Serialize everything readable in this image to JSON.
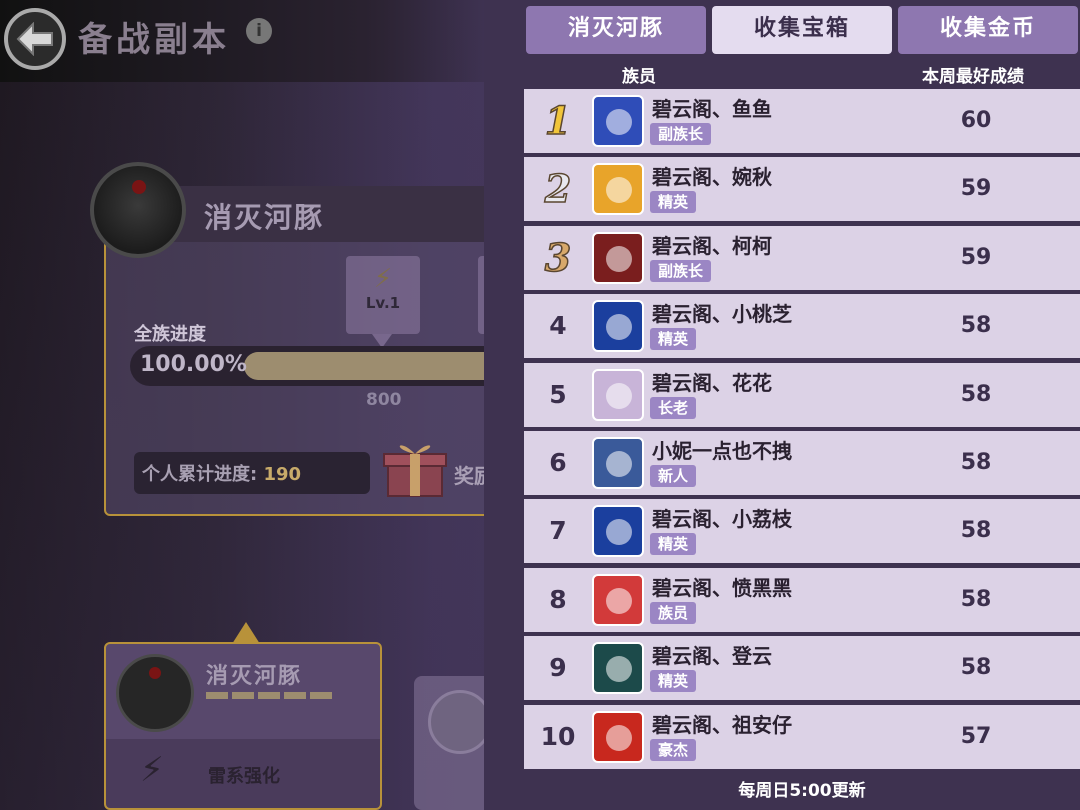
{
  "header": {
    "title": "备战副本",
    "info_icon": "i"
  },
  "dungeon": {
    "name": "消灭河豚",
    "level": "Lv.1",
    "progress_label": "全族进度",
    "progress": "100.00%",
    "progress_fraction": 1.0,
    "milestone": "800",
    "personal_label": "个人累计进度:",
    "personal_value": "190",
    "reward_label": "奖励"
  },
  "sub_dungeon": {
    "name": "消灭河豚",
    "buff": "雷系强化"
  },
  "tabs": [
    {
      "label": "消灭河豚",
      "active": false
    },
    {
      "label": "收集宝箱",
      "active": true
    },
    {
      "label": "收集金币",
      "active": false
    }
  ],
  "columns": {
    "member": "族员",
    "best_score": "本周最好成绩"
  },
  "ranking": [
    {
      "rank": "1",
      "name": "碧云阁、鱼鱼",
      "role": "副族长",
      "score": "60",
      "avatar_color": "#2f4db8"
    },
    {
      "rank": "2",
      "name": "碧云阁、婉秋",
      "role": "精英",
      "score": "59",
      "avatar_color": "#e8a42a"
    },
    {
      "rank": "3",
      "name": "碧云阁、柯柯",
      "role": "副族长",
      "score": "59",
      "avatar_color": "#7a1e1e"
    },
    {
      "rank": "4",
      "name": "碧云阁、小桃芝",
      "role": "精英",
      "score": "58",
      "avatar_color": "#1b3f9e"
    },
    {
      "rank": "5",
      "name": "碧云阁、花花",
      "role": "长老",
      "score": "58",
      "avatar_color": "#c8b4d8"
    },
    {
      "rank": "6",
      "name": "小妮一点也不拽",
      "role": "新人",
      "score": "58",
      "avatar_color": "#3a5a9a"
    },
    {
      "rank": "7",
      "name": "碧云阁、小荔枝",
      "role": "精英",
      "score": "58",
      "avatar_color": "#1b3f9e"
    },
    {
      "rank": "8",
      "name": "碧云阁、愤黑黑",
      "role": "族员",
      "score": "58",
      "avatar_color": "#d23a3a"
    },
    {
      "rank": "9",
      "name": "碧云阁、登云",
      "role": "精英",
      "score": "58",
      "avatar_color": "#1c4a4a"
    },
    {
      "rank": "10",
      "name": "碧云阁、祖安仔",
      "role": "豪杰",
      "score": "57",
      "avatar_color": "#c8281e"
    }
  ],
  "footer": "每周日5:00更新",
  "colors": {
    "panel": "#3e3250",
    "row": "#dcd2e6",
    "tab_inactive": "#8e77b0",
    "tab_active": "#e4dcef",
    "badge": "#9b86c4"
  }
}
